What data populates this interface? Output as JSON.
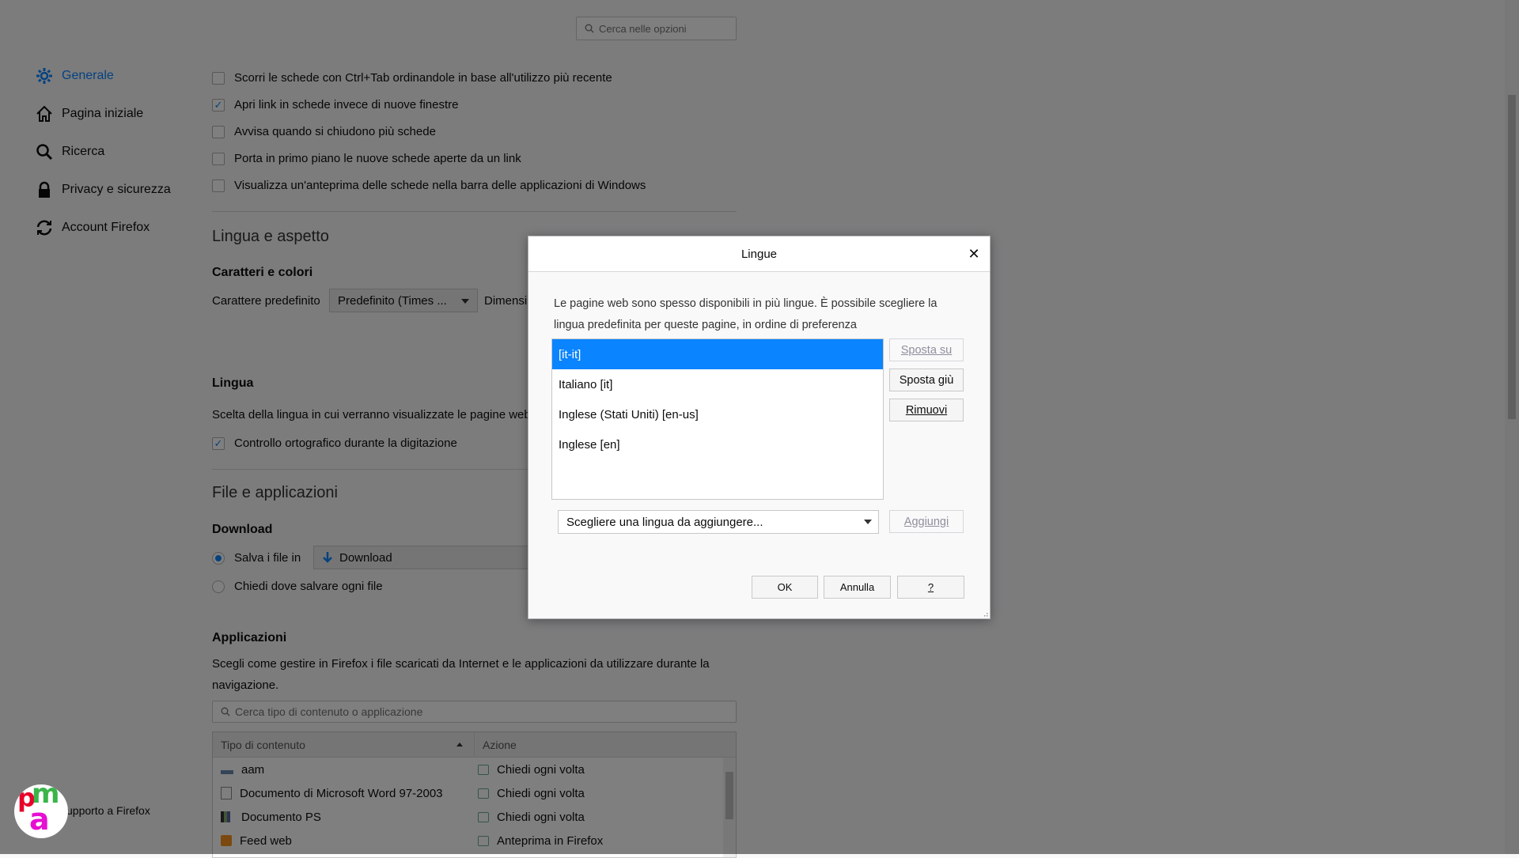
{
  "search": {
    "placeholder": "Cerca nelle opzioni"
  },
  "sidebar": {
    "items": [
      {
        "label": "Generale",
        "icon": "gear-icon",
        "active": true
      },
      {
        "label": "Pagina iniziale",
        "icon": "home-icon"
      },
      {
        "label": "Ricerca",
        "icon": "search-icon"
      },
      {
        "label": "Privacy e sicurezza",
        "icon": "lock-icon"
      },
      {
        "label": "Account Firefox",
        "icon": "sync-icon"
      }
    ],
    "support_label": "upporto a Firefox"
  },
  "tabs_options": [
    {
      "label": "Scorri le schede con Ctrl+Tab ordinandole in base all'utilizzo più recente",
      "checked": false
    },
    {
      "label": "Apri link in schede invece di nuove finestre",
      "checked": true
    },
    {
      "label": "Avvisa quando si chiudono più schede",
      "checked": false
    },
    {
      "label": "Porta in primo piano le nuove schede aperte da un link",
      "checked": false
    },
    {
      "label": "Visualizza un'anteprima delle schede nella barra delle applicazioni di Windows",
      "checked": false
    }
  ],
  "language_appearance": {
    "title": "Lingua e aspetto",
    "fonts_title": "Caratteri e colori",
    "default_font_label": "Carattere predefinito",
    "default_font_value": "Predefinito (Times ...",
    "size_label": "Dimensi"
  },
  "language": {
    "title": "Lingua",
    "description": "Scelta della lingua in cui verranno visualizzate le pagine web",
    "spellcheck_label": "Controllo ortografico durante la digitazione",
    "spellcheck_checked": true
  },
  "files_apps": {
    "title": "File e applicazioni",
    "download_title": "Download",
    "save_files_label": "Salva i file in",
    "save_folder": "Download",
    "ask_label": "Chiedi dove salvare ogni file",
    "selected": "save"
  },
  "applications": {
    "title": "Applicazioni",
    "description_line1": "Scegli come gestire in Firefox i file scaricati da Internet e le applicazioni da utilizzare durante la",
    "description_line2": "navigazione.",
    "search_placeholder": "Cerca tipo di contenuto o applicazione",
    "col_type": "Tipo di contenuto",
    "col_action": "Azione",
    "rows": [
      {
        "type": "aam",
        "action": "Chiedi ogni volta"
      },
      {
        "type": "Documento di Microsoft Word 97-2003",
        "action": "Chiedi ogni volta"
      },
      {
        "type": "Documento PS",
        "action": "Chiedi ogni volta"
      },
      {
        "type": "Feed web",
        "action": "Anteprima in Firefox"
      }
    ]
  },
  "dialog": {
    "title": "Lingue",
    "description": "Le pagine web sono spesso disponibili in più lingue. È possibile scegliere la lingua predefinita per queste pagine, in ordine di preferenza",
    "languages": [
      {
        "label": "[it-it]",
        "selected": true
      },
      {
        "label": "Italiano  [it]"
      },
      {
        "label": "Inglese (Stati Uniti)  [en-us]"
      },
      {
        "label": "Inglese  [en]"
      }
    ],
    "move_up": "Sposta su",
    "move_down": "Sposta giù",
    "remove": "Rimuovi",
    "select_placeholder": "Scegliere una lingua da aggiungere...",
    "add": "Aggiungi",
    "ok": "OK",
    "cancel": "Annulla",
    "help": "?"
  },
  "logo": {
    "letters": [
      "p",
      "m",
      "a"
    ]
  },
  "colors": {
    "accent": "#0a84ff",
    "overlay": "rgba(0,0,0,0.5)"
  }
}
